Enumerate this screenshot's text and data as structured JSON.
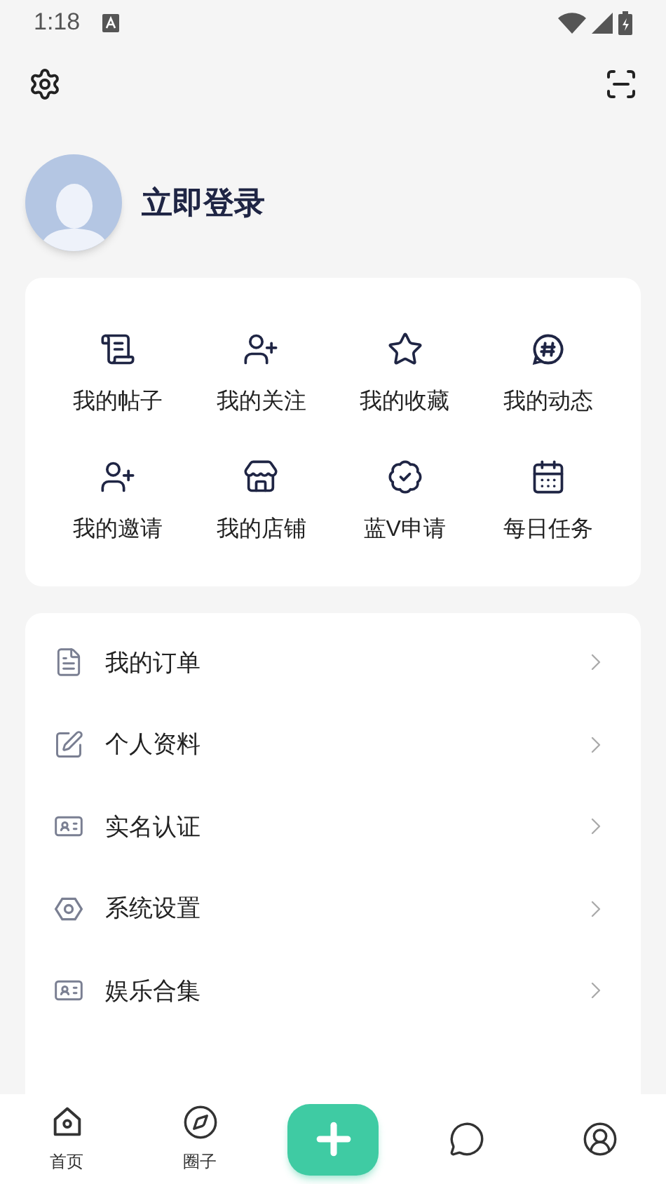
{
  "status_bar": {
    "time": "1:18"
  },
  "profile": {
    "login_label": "立即登录"
  },
  "shortcuts": [
    {
      "label": "我的帖子"
    },
    {
      "label": "我的关注"
    },
    {
      "label": "我的收藏"
    },
    {
      "label": "我的动态"
    },
    {
      "label": "我的邀请"
    },
    {
      "label": "我的店铺"
    },
    {
      "label": "蓝V申请"
    },
    {
      "label": "每日任务"
    }
  ],
  "menu": [
    {
      "label": "我的订单"
    },
    {
      "label": "个人资料"
    },
    {
      "label": "实名认证"
    },
    {
      "label": "系统设置"
    },
    {
      "label": "娱乐合集"
    }
  ],
  "bottom_nav": [
    {
      "kind": "tab",
      "label": "首页"
    },
    {
      "kind": "tab",
      "label": "圈子"
    },
    {
      "kind": "add"
    },
    {
      "kind": "tab"
    },
    {
      "kind": "tab"
    }
  ]
}
